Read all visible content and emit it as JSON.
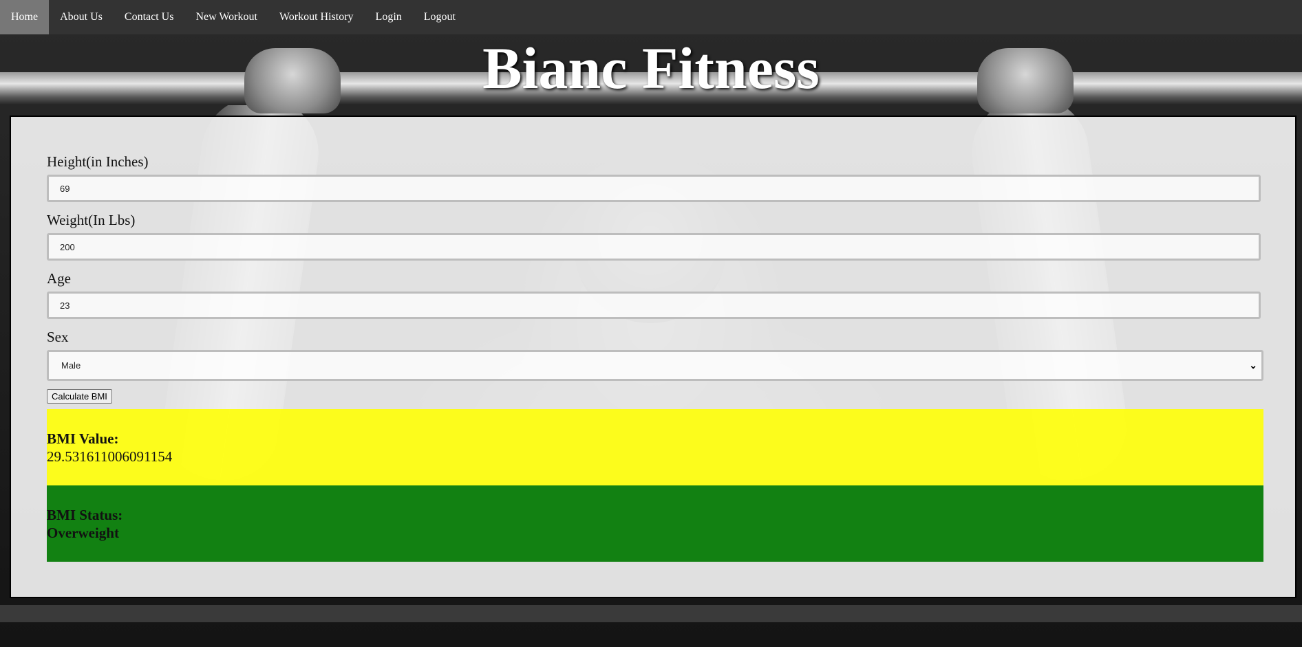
{
  "nav": {
    "items": [
      {
        "label": "Home"
      },
      {
        "label": "About Us"
      },
      {
        "label": "Contact Us"
      },
      {
        "label": "New Workout"
      },
      {
        "label": "Workout History"
      },
      {
        "label": "Login"
      },
      {
        "label": "Logout"
      }
    ],
    "active": "Home"
  },
  "site": {
    "title": "Bianc Fitness"
  },
  "form": {
    "height_label": "Height(in Inches)",
    "height_value": "69",
    "weight_label": "Weight(In Lbs)",
    "weight_value": "200",
    "age_label": "Age",
    "age_value": "23",
    "sex_label": "Sex",
    "sex_selected": "Male",
    "calculate_button": "Calculate BMI"
  },
  "results": {
    "bmi_value_label": "BMI Value:",
    "bmi_value": "29.531611006091154",
    "bmi_status_label": "BMI Status:",
    "bmi_status": "Overweight"
  },
  "colors": {
    "nav_bg": "#333333",
    "nav_active": "#777777",
    "value_box": "#ffff00",
    "status_box": "#007800"
  }
}
